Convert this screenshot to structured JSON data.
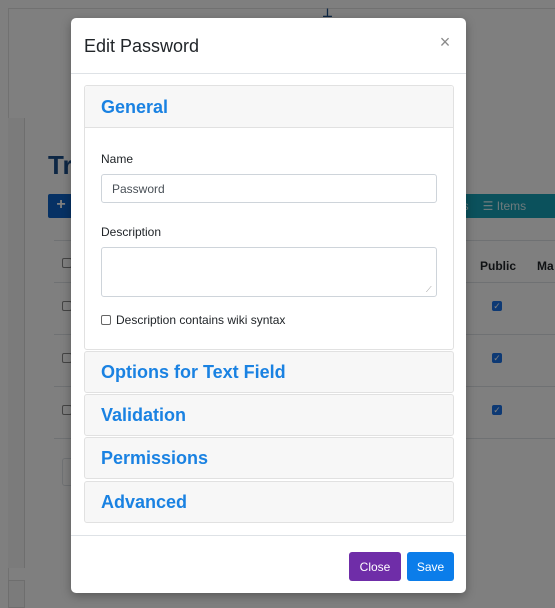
{
  "background": {
    "heading": "Tr",
    "add_button_glyph": "+",
    "toolbar_left_label": "ers",
    "toolbar_items_glyph": "☰",
    "toolbar_items_label": "Items",
    "table_headers": {
      "public": "Public",
      "ma": "Ma"
    }
  },
  "modal": {
    "title": "Edit Password",
    "close_glyph": "×",
    "general": {
      "title": "General",
      "name_label": "Name",
      "name_value": "Password",
      "description_label": "Description",
      "description_value": "",
      "wiki_label": "Description contains wiki syntax"
    },
    "sections": [
      {
        "title": "Options for Text Field"
      },
      {
        "title": "Validation"
      },
      {
        "title": "Permissions"
      },
      {
        "title": "Advanced"
      }
    ],
    "footer": {
      "close_label": "Close",
      "save_label": "Save"
    }
  },
  "colors": {
    "accent": "#1a82e2",
    "close_button": "#6f2da8",
    "save_button": "#0b7dea"
  }
}
